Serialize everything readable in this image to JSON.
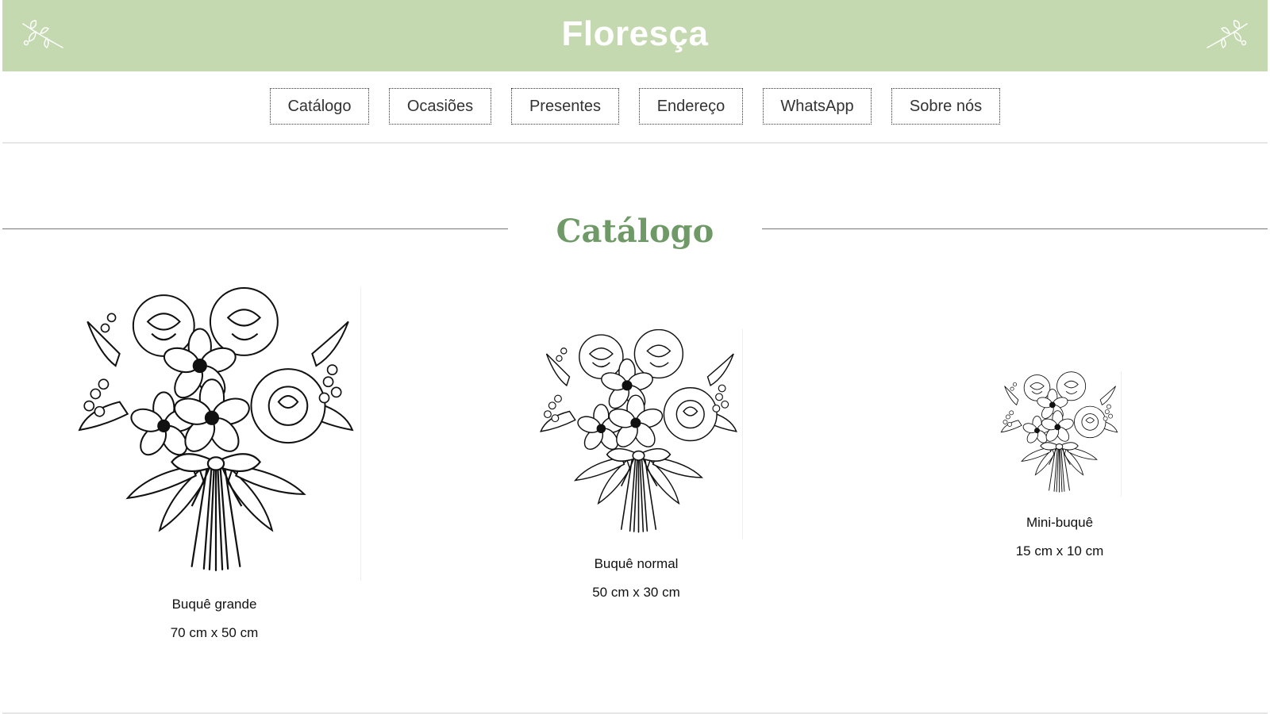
{
  "header": {
    "brand": "Floresça",
    "ornament_icon": "flower-sprig-icon"
  },
  "nav": {
    "items": [
      {
        "label": "Catálogo"
      },
      {
        "label": "Ocasiões"
      },
      {
        "label": "Presentes"
      },
      {
        "label": "Endereço"
      },
      {
        "label": "WhatsApp"
      },
      {
        "label": "Sobre nós"
      }
    ]
  },
  "catalog": {
    "title": "Catálogo",
    "products": [
      {
        "name": "Buquê grande",
        "size": "70 cm x 50 cm",
        "image_icon": "bouquet-illustration-icon"
      },
      {
        "name": "Buquê normal",
        "size": "50 cm x 30 cm",
        "image_icon": "bouquet-illustration-icon"
      },
      {
        "name": "Mini-buquê",
        "size": "15 cm x 10 cm",
        "image_icon": "bouquet-illustration-icon"
      }
    ]
  },
  "colors": {
    "header_bg": "#c5d9b0",
    "title_green": "#6f9a67"
  }
}
